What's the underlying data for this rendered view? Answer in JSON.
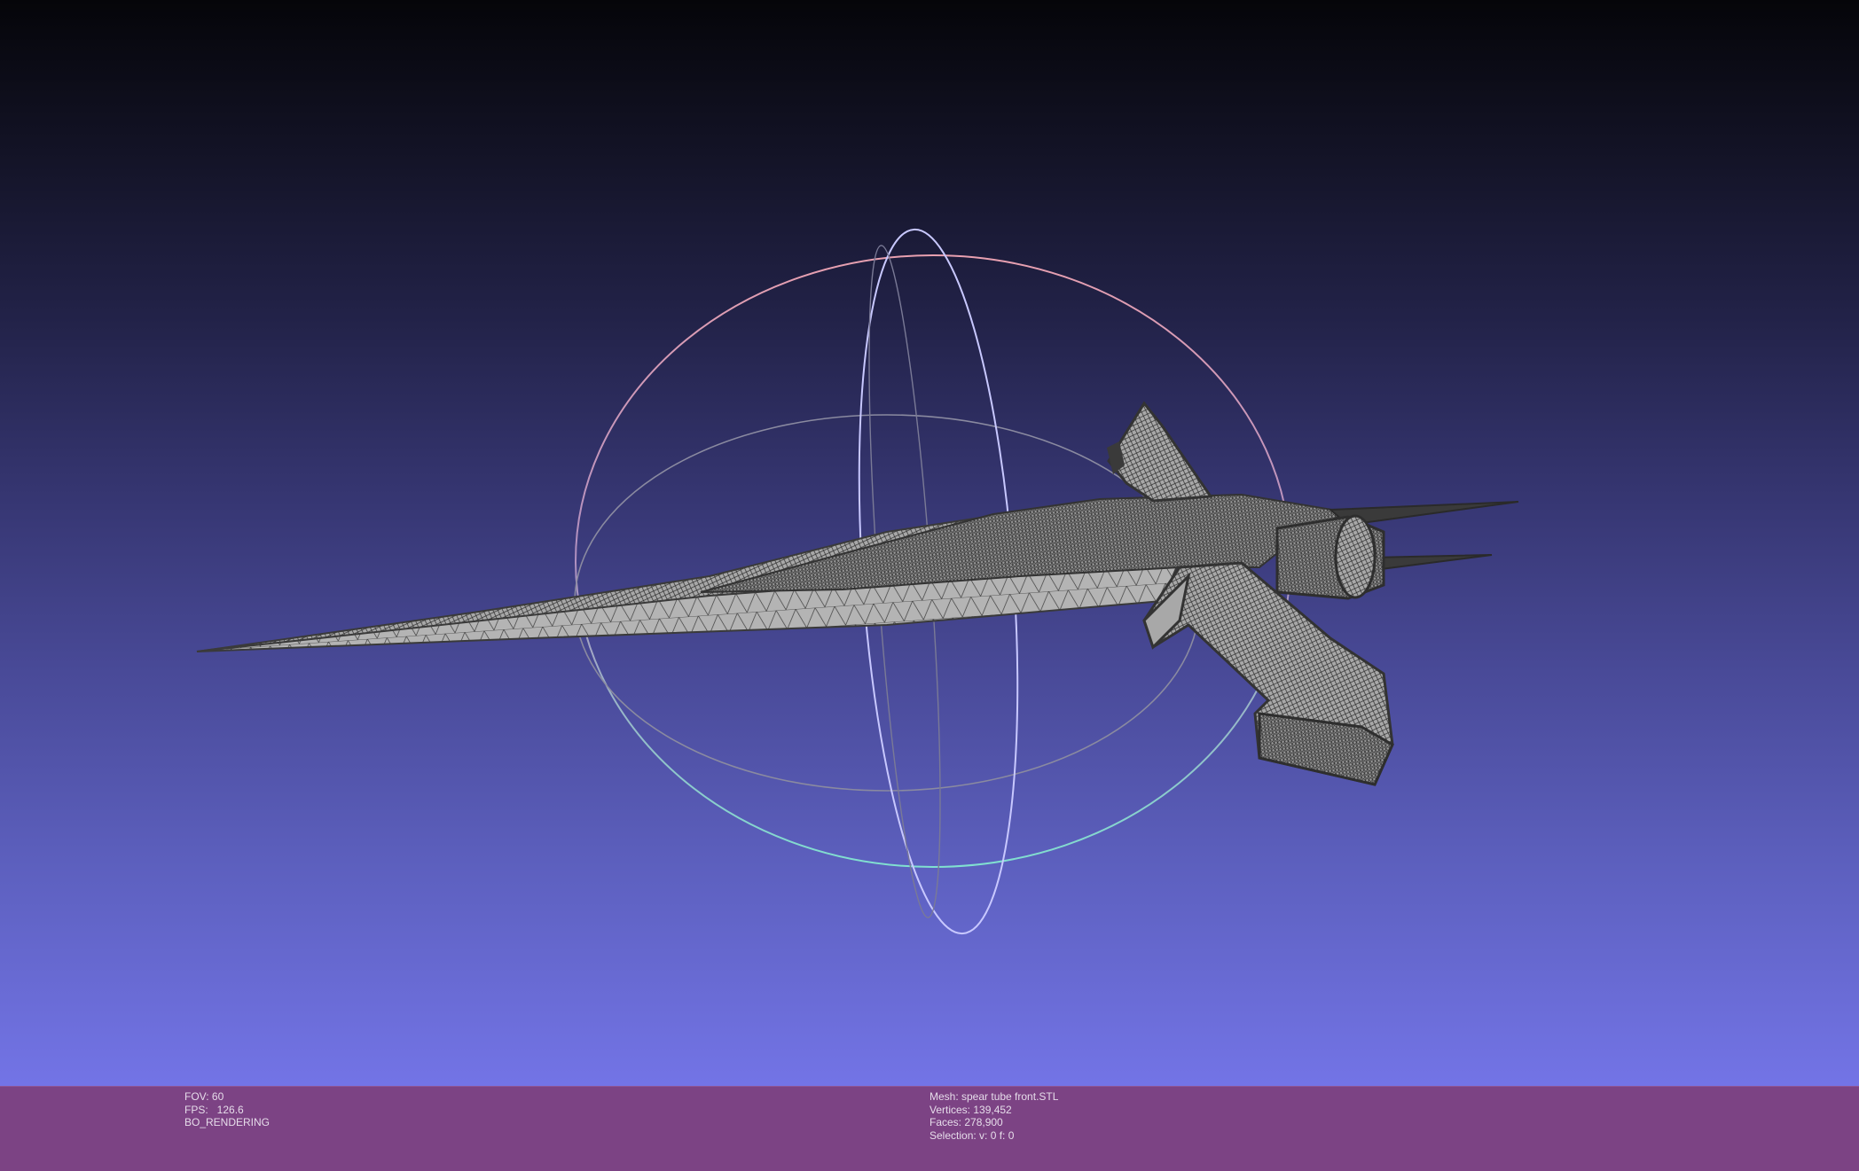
{
  "app": {
    "background_top_color": "#050509",
    "background_bottom_color": "#7374e6",
    "info_bar_color": "#7c4384"
  },
  "viewport": {
    "mesh_color": "#a8a8a8",
    "wire_color": "#2a2a2a",
    "trackball": {
      "horizontal_ring_color": "#e8a0b0",
      "horizontal_ring_bottom_color": "#80e0d0",
      "vertical_ring_color": "#c8c8ff",
      "inner_ring_color": "#8a8aa0"
    }
  },
  "status_left": {
    "fov": "FOV: 60",
    "fps": "FPS:   126.6",
    "mode": "BO_RENDERING"
  },
  "status_right": {
    "mesh": "Mesh: spear tube front.STL",
    "vertices": "Vertices: 139,452",
    "faces": "Faces: 278,900",
    "selection": "Selection: v: 0 f: 0"
  }
}
